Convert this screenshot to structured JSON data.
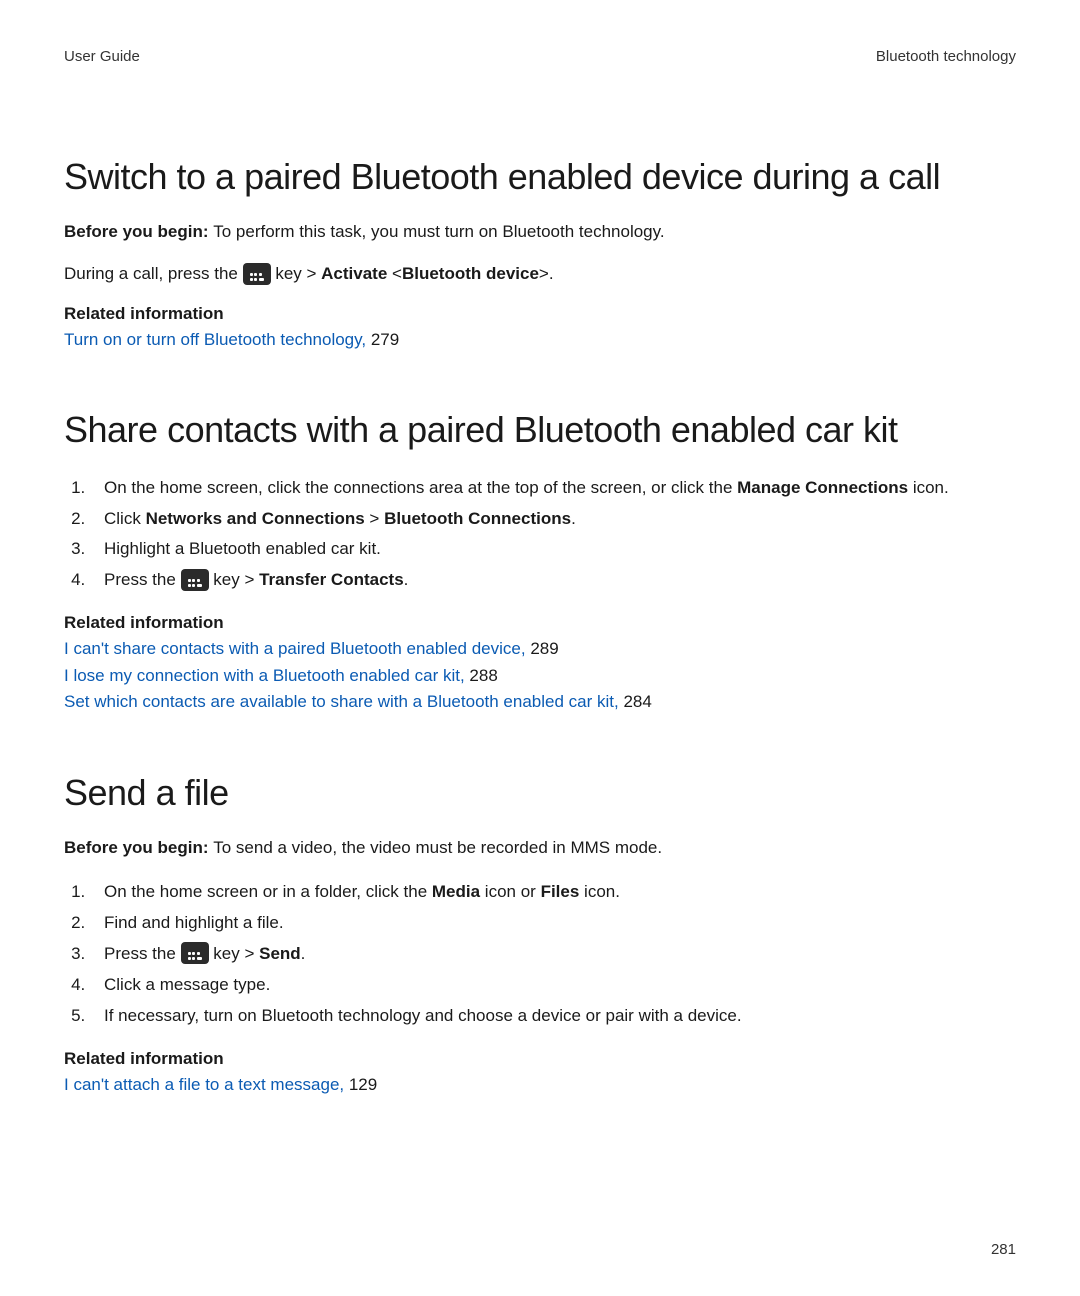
{
  "header": {
    "left": "User Guide",
    "right": "Bluetooth technology"
  },
  "page_number": "281",
  "sections": [
    {
      "title": "Switch to a paired Bluetooth enabled device during a call",
      "before_begin_label": "Before you begin: ",
      "before_begin_text": "To perform this task, you must turn on Bluetooth technology.",
      "step_line_prefix": "During a call, press the ",
      "step_line_key_after": " key > ",
      "step_line_bold_a": "Activate",
      "step_line_mid": " <",
      "step_line_bold_b": "Bluetooth device",
      "step_line_end": ">.",
      "related_heading": "Related information",
      "related": [
        {
          "text": "Turn on or turn off Bluetooth technology, ",
          "page": "279"
        }
      ]
    },
    {
      "title": "Share contacts with a paired Bluetooth enabled car kit",
      "steps": [
        {
          "pre": "On the home screen, click the connections area at the top of the screen, or click the ",
          "bold_a": "Manage Connections",
          "post_a": " icon."
        },
        {
          "pre": "Click ",
          "bold_a": "Networks and Connections",
          "mid": " > ",
          "bold_b": "Bluetooth Connections",
          "post_b": "."
        },
        {
          "pre": "Highlight a Bluetooth enabled car kit."
        },
        {
          "pre": "Press the ",
          "has_key_icon": true,
          "post_key": " key > ",
          "bold_a": "Transfer Contacts",
          "post_a": "."
        }
      ],
      "related_heading": "Related information",
      "related": [
        {
          "text": "I can't share contacts with a paired Bluetooth enabled device, ",
          "page": "289"
        },
        {
          "text": "I lose my connection with a Bluetooth enabled car kit, ",
          "page": "288"
        },
        {
          "text": "Set which contacts are available to share with a Bluetooth enabled car kit, ",
          "page": "284"
        }
      ]
    },
    {
      "title": "Send a file",
      "before_begin_label": "Before you begin: ",
      "before_begin_text": "To send a video, the video must be recorded in MMS mode.",
      "steps": [
        {
          "pre": "On the home screen or in a folder, click the ",
          "bold_a": "Media",
          "mid": " icon or ",
          "bold_b": "Files",
          "post_b": " icon."
        },
        {
          "pre": "Find and highlight a file."
        },
        {
          "pre": "Press the ",
          "has_key_icon": true,
          "post_key": " key > ",
          "bold_a": "Send",
          "post_a": "."
        },
        {
          "pre": "Click a message type."
        },
        {
          "pre": "If necessary, turn on Bluetooth technology and choose a device or pair with a device."
        }
      ],
      "related_heading": "Related information",
      "related": [
        {
          "text": "I can't attach a file to a text message, ",
          "page": "129"
        }
      ]
    }
  ]
}
